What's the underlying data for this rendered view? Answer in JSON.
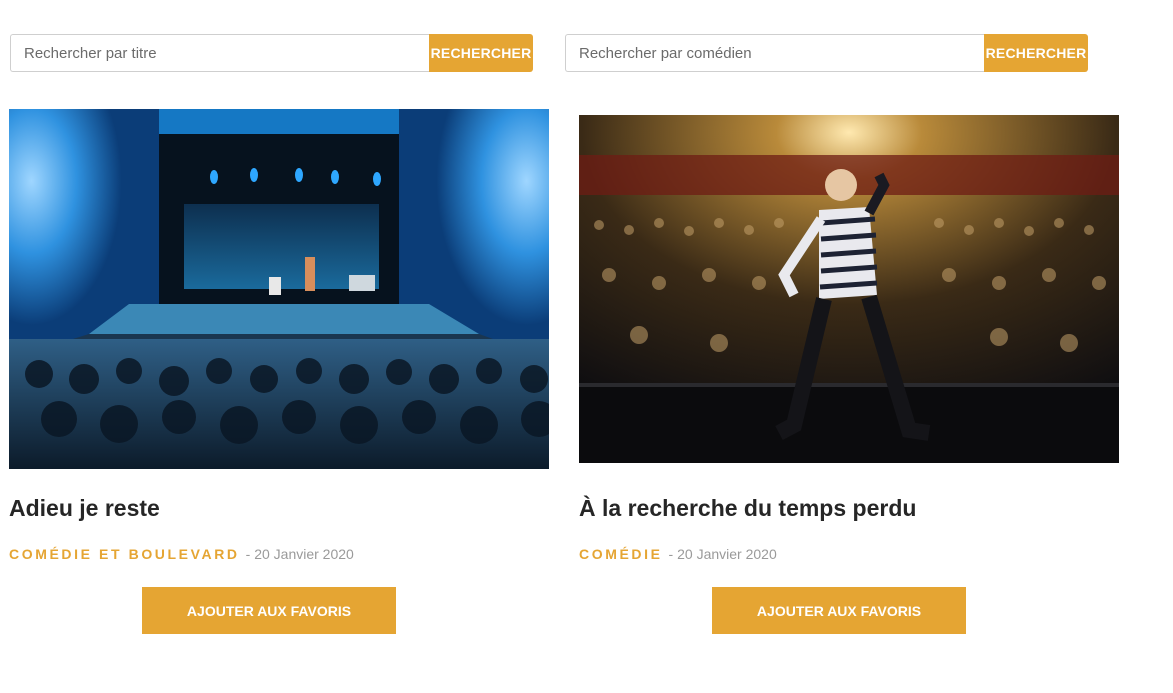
{
  "search_title": {
    "placeholder": "Rechercher par titre",
    "button_label": "RECHERCHER"
  },
  "search_actor": {
    "placeholder": "Rechercher par comédien",
    "button_label": "RECHERCHER"
  },
  "cards": [
    {
      "title": "Adieu je reste",
      "category": "COMÉDIE ET BOULEVARD",
      "separator": "-",
      "date": "20 Janvier 2020",
      "favorite_label": "AJOUTER AUX FAVORIS"
    },
    {
      "title": "À la recherche du temps perdu",
      "category": "COMÉDIE",
      "separator": "-",
      "date": "20 Janvier 2020",
      "favorite_label": "AJOUTER AUX FAVORIS"
    }
  ],
  "colors": {
    "accent": "#e5a533",
    "title": "#262626",
    "muted": "#9a9a9a"
  }
}
